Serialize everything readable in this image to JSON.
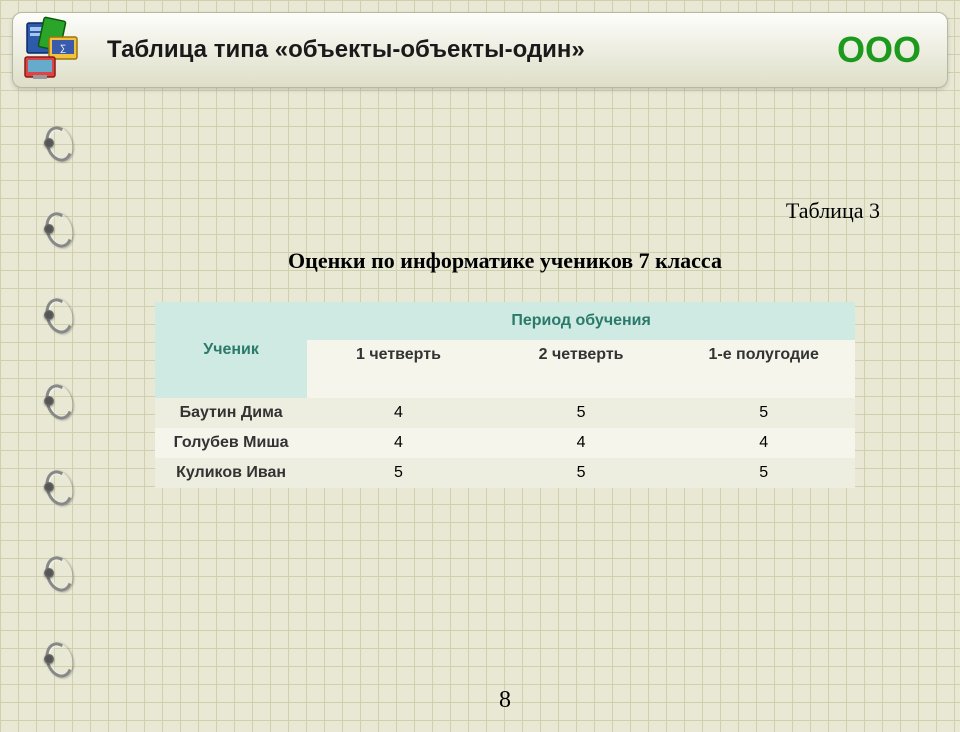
{
  "header": {
    "title": "Таблица типа «объекты-объекты-один»",
    "badge": "ООО",
    "icon_name": "books-computer-icon"
  },
  "caption_number": "Таблица 3",
  "table_title": "Оценки по информатике учеников 7 класса",
  "columns": {
    "student": "Ученик",
    "period_group": "Период обучения",
    "periods": [
      "1 четверть",
      "2 четверть",
      "1-е полугодие"
    ]
  },
  "rows": [
    {
      "student": "Баутин Дима",
      "grades": [
        4,
        5,
        5
      ]
    },
    {
      "student": "Голубев Миша",
      "grades": [
        4,
        4,
        4
      ]
    },
    {
      "student": "Куликов Иван",
      "grades": [
        5,
        5,
        5
      ]
    }
  ],
  "page_number": "8",
  "chart_data": {
    "type": "table",
    "title": "Оценки по информатике учеников 7 класса",
    "columns": [
      "Ученик",
      "1 четверть",
      "2 четверть",
      "1-е полугодие"
    ],
    "rows": [
      [
        "Баутин Дима",
        4,
        5,
        5
      ],
      [
        "Голубев Миша",
        4,
        4,
        4
      ],
      [
        "Куликов Иван",
        5,
        5,
        5
      ]
    ]
  }
}
